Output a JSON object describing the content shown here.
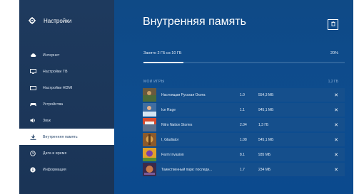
{
  "sidebar": {
    "title": "Настройки",
    "items": [
      {
        "label": "Интернет",
        "icon": "cloud-icon"
      },
      {
        "label": "Настройки ТВ",
        "icon": "tv-icon"
      },
      {
        "label": "Настройки HDMI",
        "icon": "hdmi-icon"
      },
      {
        "label": "Устройства",
        "icon": "gamepad-icon"
      },
      {
        "label": "Звук",
        "icon": "speaker-icon"
      },
      {
        "label": "Внутренняя память",
        "icon": "download-icon"
      },
      {
        "label": "Дата и время",
        "icon": "clock-icon"
      },
      {
        "label": "Информация",
        "icon": "info-icon"
      }
    ],
    "active_index": 5
  },
  "main": {
    "title": "Внутренняя память",
    "usage_text": "Занято 2 ГБ из 10 ГБ",
    "usage_percent_text": "20%",
    "usage_fraction": 0.2,
    "section_label": "МОИ ИГРЫ",
    "section_size": "1,2 ГБ",
    "games": [
      {
        "name": "Настоящая Русская Охота",
        "version": "1.0",
        "size": "554,3 МБ"
      },
      {
        "name": "Ice Rage",
        "version": "1.1",
        "size": "945,1 МБ"
      },
      {
        "name": "Nitro Nation Stories",
        "version": "2.04",
        "size": "1,3 ГБ"
      },
      {
        "name": "I, Gladiator",
        "version": "1.08",
        "size": "545,1 МБ"
      },
      {
        "name": "Farm Invasion",
        "version": "8.1",
        "size": "935 МБ"
      },
      {
        "name": "Таинственный парк: последн...",
        "version": "1.7",
        "size": "234 МБ"
      }
    ]
  },
  "colors": {
    "sidebar_bg": "#1e3a5e",
    "main_bg": "#0d4c8f",
    "row_bg": "#154f8c",
    "active_item_bg": "#ffffff"
  }
}
